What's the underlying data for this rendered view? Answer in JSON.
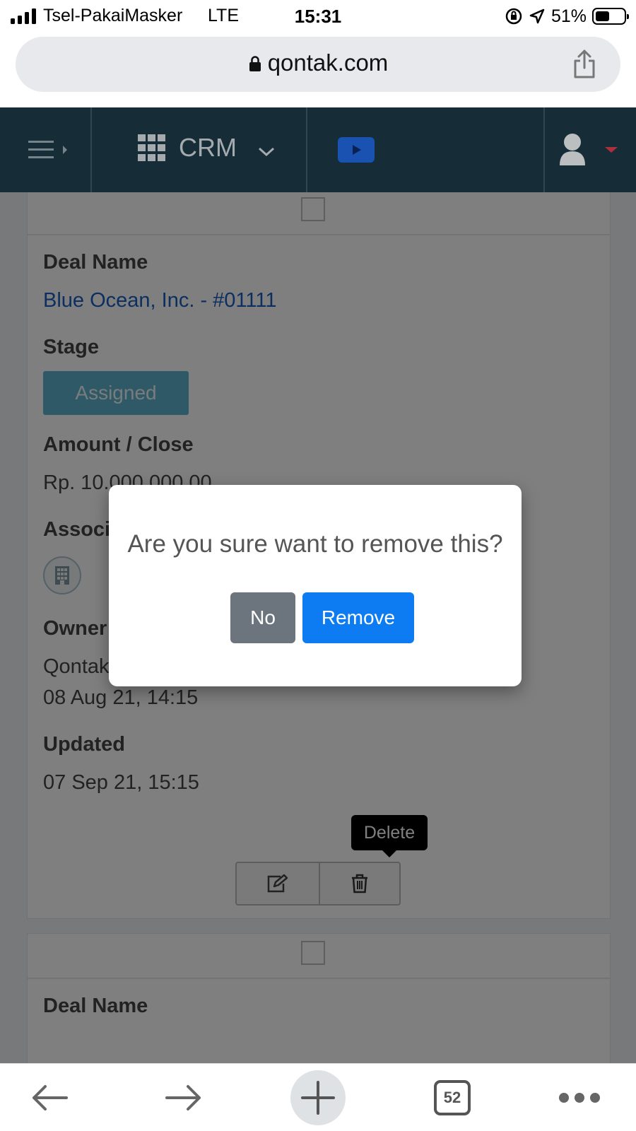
{
  "status_bar": {
    "carrier": "Tsel-PakaiMasker",
    "network": "LTE",
    "time": "15:31",
    "battery": "51%",
    "battery_level": 0.51
  },
  "browser": {
    "url": "qontak.com",
    "tab_count": "52"
  },
  "app_header": {
    "app_name": "CRM"
  },
  "deal_card": {
    "deal_name_label": "Deal Name",
    "deal_name": "Blue Ocean, Inc. - #01111",
    "stage_label": "Stage",
    "stage": "Assigned",
    "amount_label": "Amount / Close",
    "amount": "Rp. 10.000.000,00",
    "associated_label": "Associated",
    "owner_label": "Owner",
    "owner": "Qontak",
    "created": "08 Aug 21, 14:15",
    "updated_label": "Updated",
    "updated": "07 Sep 21, 15:15",
    "delete_tooltip": "Delete"
  },
  "next_card": {
    "deal_name_label": "Deal Name"
  },
  "dialog": {
    "message": "Are you sure want to remove this?",
    "no_label": "No",
    "remove_label": "Remove"
  },
  "colors": {
    "header_bg": "#1c3745",
    "primary": "#0d7cf2",
    "secondary": "#6c757d",
    "stage_badge": "#5fb3cc",
    "link": "#1b5fc1"
  }
}
